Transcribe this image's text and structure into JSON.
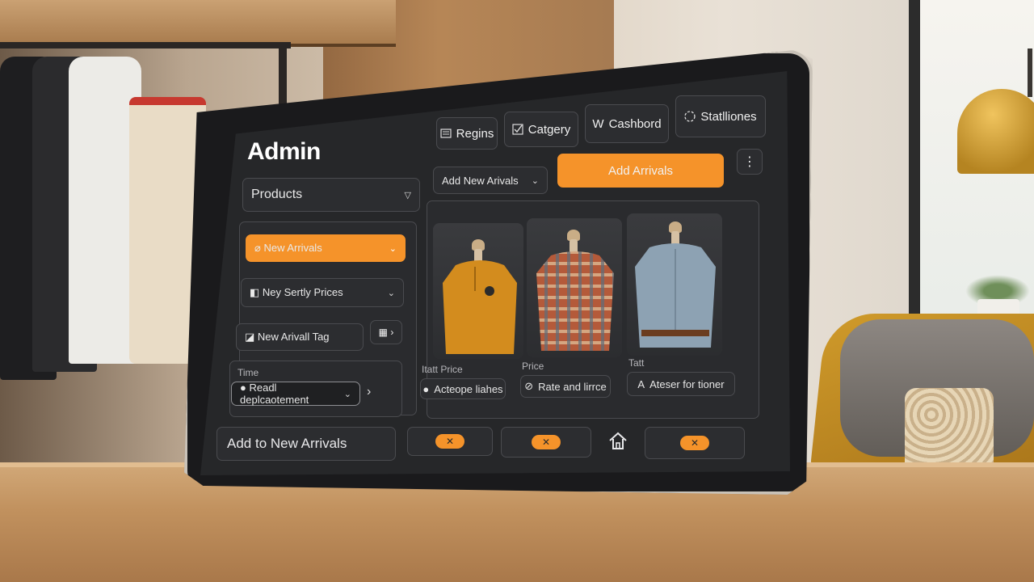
{
  "admin": {
    "title": "Admin"
  },
  "top_nav": {
    "items": [
      {
        "label": "Regins",
        "icon": "list-icon"
      },
      {
        "label": "Catgery",
        "icon": "checkbox-icon"
      },
      {
        "label": "Cashbord",
        "icon": "w-logo-icon",
        "prefix": "W"
      },
      {
        "label": "Statlliones",
        "icon": "circle-dashed-icon"
      }
    ],
    "more_icon": "kebab-menu-icon"
  },
  "sidebar": {
    "products_label": "Products",
    "filters": [
      {
        "label": "New Arrivals",
        "icon": "tag-icon",
        "active": true
      },
      {
        "label": "Ney Sertly Prices",
        "icon": "toggle-icon",
        "active": false
      },
      {
        "label": "New Arivall Tag",
        "icon": "tag-icon",
        "active": false
      }
    ],
    "side_button_icon": "grid-arrow-icon",
    "time": {
      "label": "Time",
      "value": "Readl deplcaotement",
      "next_icon": "chevron-right-icon"
    },
    "footer_label": "Add to New Arrivals"
  },
  "toolbar": {
    "select_label": "Add New Arivals",
    "primary_button": "Add Arrivals"
  },
  "products": [
    {
      "name": "mustard-hoodie",
      "color": "#d38c1e"
    },
    {
      "name": "plaid-shirt",
      "color": "#b45a3a"
    },
    {
      "name": "denim-shirt",
      "color": "#8da2b3"
    }
  ],
  "product_fields": [
    {
      "label": "Itatt Price",
      "button": "Acteope liahes"
    },
    {
      "label": "Price",
      "button": "Rate and lirrce"
    },
    {
      "label": "Tatt",
      "button": "Ateser for tioner"
    }
  ],
  "bottom_actions": [
    {
      "badge": "✕"
    },
    {
      "badge": "✕"
    },
    {
      "icon": "home-icon"
    },
    {
      "badge": "✕"
    }
  ],
  "colors": {
    "accent": "#f5932a",
    "screen_bg": "#262729"
  }
}
